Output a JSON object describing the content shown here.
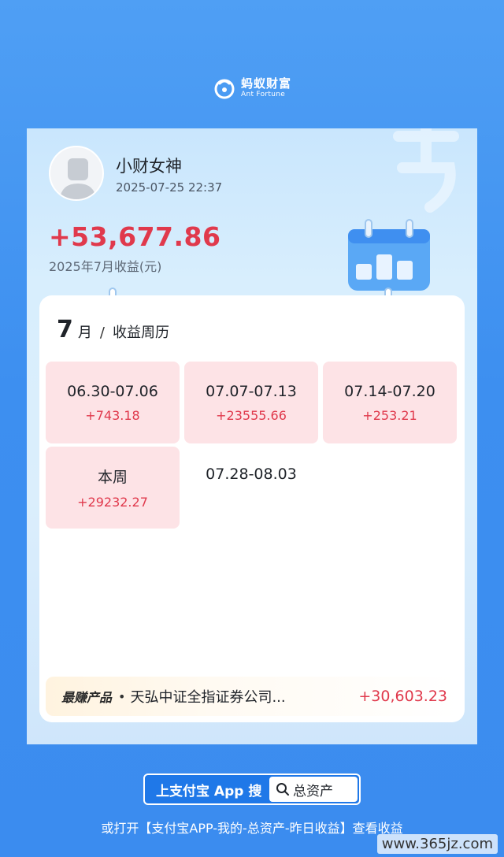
{
  "brand": {
    "name_cn": "蚂蚁财富",
    "name_en": "Ant Fortune"
  },
  "user": {
    "name": "小财女神",
    "time": "2025-07-25 22:37"
  },
  "summary": {
    "income": "+53,677.86",
    "label": "2025年7月收益(元)"
  },
  "calendar": {
    "month": "7",
    "month_unit": "月",
    "separator": "/",
    "title": "收益周历",
    "weeks": [
      {
        "range": "06.30-07.06",
        "value": "+743.18"
      },
      {
        "range": "07.07-07.13",
        "value": "+23555.66"
      },
      {
        "range": "07.14-07.20",
        "value": "+253.21"
      },
      {
        "range": "本周",
        "value": "+29232.27"
      },
      {
        "range": "07.28-08.03",
        "value": ""
      }
    ]
  },
  "top_product": {
    "badge": "最赚产品",
    "name": "天弘中证全指证券公司...",
    "value": "+30,603.23"
  },
  "search": {
    "label": "上支付宝 App 搜",
    "query": "总资产",
    "icon": "search-icon"
  },
  "footer": {
    "hint": "或打开【支付宝APP-我的-总资产-昨日收益】查看收益"
  },
  "watermark": {
    "site": "www.365jz.com"
  },
  "colors": {
    "accent_red": "#e0394c",
    "brand_blue": "#3d8ff0",
    "week_bg": "#fde3e6"
  }
}
